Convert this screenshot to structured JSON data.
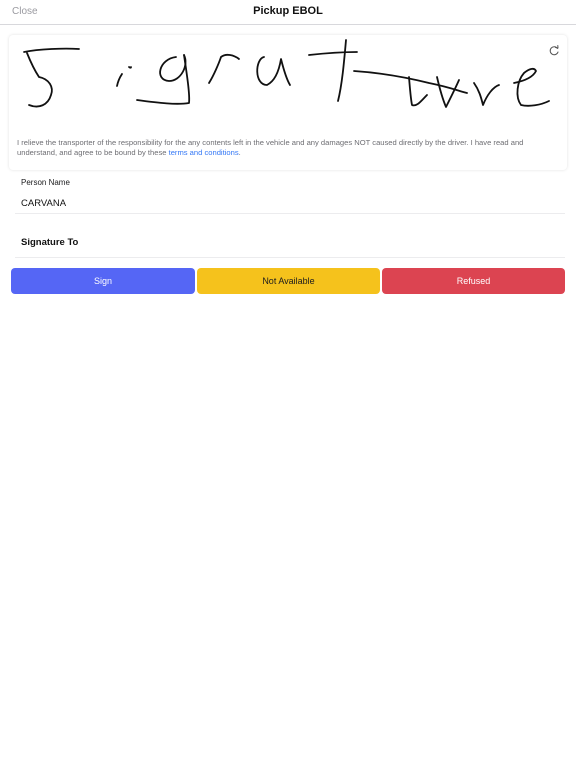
{
  "navbar": {
    "close_label": "Close",
    "title": "Pickup EBOL"
  },
  "signature": {
    "handwritten_text": "Signature",
    "ink_color": "#111111",
    "disclaimer_text": "I relieve the transporter of the responsibility for the any contents left in the vehicle and any damages NOT caused directly by the driver. I have read and understand, and agree to be bound by these ",
    "terms_link_label": "terms and conditions",
    "disclaimer_end": ".",
    "refresh_icon": "refresh-icon"
  },
  "person": {
    "label": "Person Name",
    "value": "CARVANA"
  },
  "signature_to": {
    "label": "Signature To"
  },
  "actions": {
    "sign_label": "Sign",
    "not_available_label": "Not Available",
    "refused_label": "Refused",
    "sign_color": "#5566f5",
    "not_available_color": "#f5c21c",
    "refused_color": "#dc4451"
  }
}
